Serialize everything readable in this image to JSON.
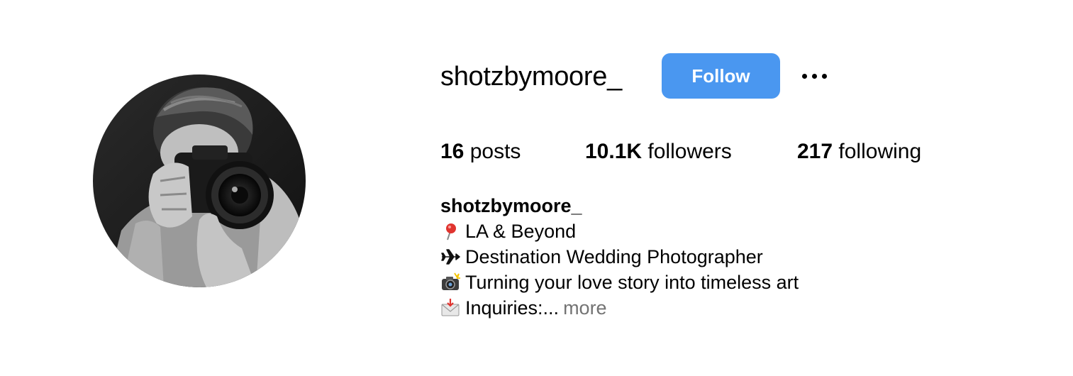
{
  "profile": {
    "username": "shotzbymoore_",
    "follow_label": "Follow",
    "follow_color": "#4a97f0",
    "more_icon": "more-options-icon"
  },
  "stats": {
    "posts": {
      "value": "16",
      "label": "posts"
    },
    "followers": {
      "value": "10.1K",
      "label": "followers"
    },
    "following": {
      "value": "217",
      "label": "following"
    }
  },
  "bio": {
    "display_name": "shotzbymoore_",
    "lines": [
      {
        "icon": "pushpin-icon",
        "text": "LA & Beyond"
      },
      {
        "icon": "airplane-icon",
        "text": "Destination Wedding Photographer"
      },
      {
        "icon": "camera-flash-icon",
        "text": "Turning your love story into timeless art"
      },
      {
        "icon": "envelope-arrow-icon",
        "text": "Inquiries:..."
      }
    ],
    "more_label": "more"
  }
}
